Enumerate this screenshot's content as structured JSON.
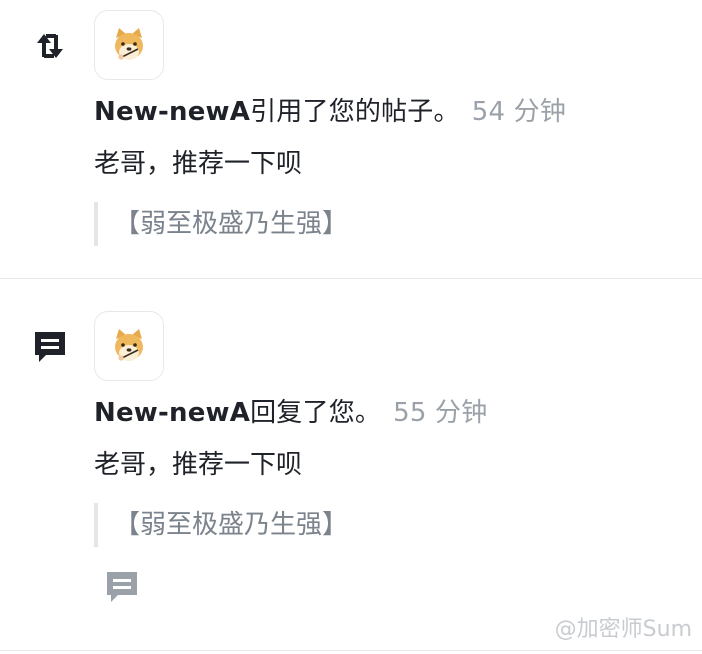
{
  "notifications": [
    {
      "type_icon": "retweet-icon",
      "avatar_icon": "shiba-dog-avatar-icon",
      "username": "New-newA",
      "action": "引用了您的帖子。",
      "time": "54 分钟",
      "content": "老哥，推荐一下呗",
      "quote": "【弱至极盛乃生强】"
    },
    {
      "type_icon": "comment-icon",
      "avatar_icon": "shiba-dog-avatar-icon",
      "username": "New-newA",
      "action": "回复了您。",
      "time": "55 分钟",
      "content": "老哥，推荐一下呗",
      "quote": "【弱至极盛乃生强】",
      "reply_icon": "reply-comment-icon"
    }
  ],
  "watermark": "@加密师Sum",
  "colors": {
    "text": "#1f2329",
    "muted": "#9aa1a8",
    "quote_text": "#7b838c",
    "divider": "#e6e8eb",
    "icon_dark": "#1f2329",
    "icon_light": "#9aa1a8"
  }
}
